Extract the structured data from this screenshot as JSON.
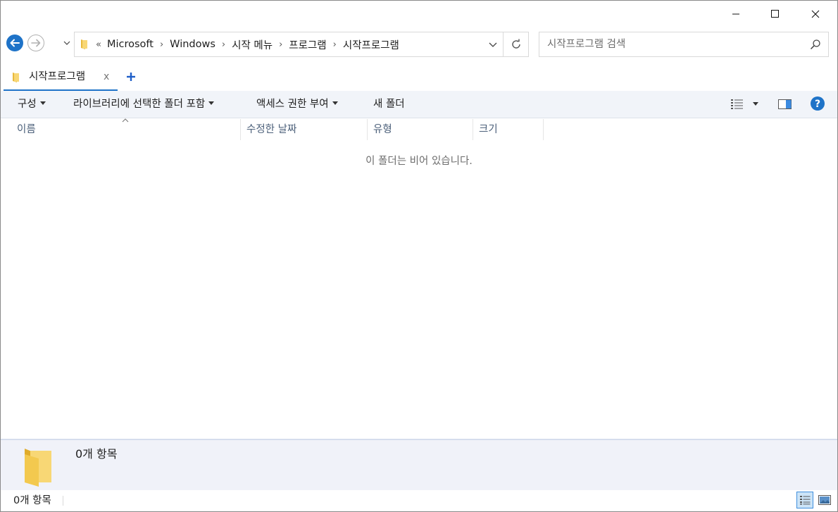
{
  "window": {
    "controls": {
      "minimize_icon": "minimize-icon",
      "maximize_icon": "maximize-icon",
      "close_icon": "close-icon"
    }
  },
  "nav": {
    "back_icon": "back-arrow-icon",
    "forward_icon": "forward-arrow-icon",
    "address": {
      "overflow": "«",
      "crumbs": [
        "Microsoft",
        "Windows",
        "시작 메뉴",
        "프로그램",
        "시작프로그램"
      ]
    },
    "search_placeholder": "시작프로그램 검색"
  },
  "tabs": [
    {
      "label": "시작프로그램",
      "close": "x"
    }
  ],
  "commands": {
    "organize": "구성",
    "include_in_library": "라이브러리에 선택한 폴더 포함",
    "share_with": "액세스 권한 부여",
    "new_folder": "새 폴더"
  },
  "columns": [
    "이름",
    "수정한 날짜",
    "유형",
    "크기"
  ],
  "empty_message": "이 폴더는 비어 있습니다.",
  "details_pane": {
    "count": "0개 항목"
  },
  "status": {
    "count": "0개 항목"
  },
  "colors": {
    "accent": "#1e73c8",
    "command_bar": "#f1f4f9",
    "details_pane": "#f0f2f9",
    "folder": "#f8d775"
  }
}
